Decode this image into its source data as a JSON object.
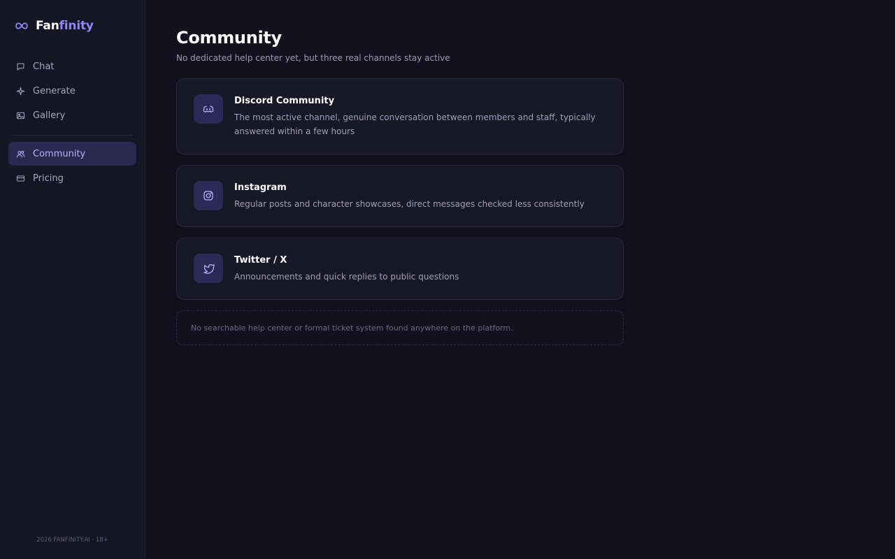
{
  "brand": {
    "prefix": "Fan",
    "suffix": "finity",
    "icon": "infinity-icon",
    "accent": "#8f86ff"
  },
  "sidebar": {
    "items": [
      {
        "label": "Chat",
        "icon": "chat-icon",
        "active": false
      },
      {
        "label": "Generate",
        "icon": "sparkle-icon",
        "active": false
      },
      {
        "label": "Gallery",
        "icon": "image-icon",
        "active": false
      },
      {
        "label": "Community",
        "icon": "users-icon",
        "active": true
      },
      {
        "label": "Pricing",
        "icon": "credit-card-icon",
        "active": false
      }
    ],
    "footer": "2026 FANFINITY.AI · 18+"
  },
  "main": {
    "title": "Community",
    "subtitle": "No dedicated help center yet, but three real channels stay active",
    "channels": [
      {
        "title": "Discord Community",
        "icon": "discord-icon",
        "description": "The most active channel, genuine conversation between members and staff, typically answered within a few hours"
      },
      {
        "title": "Instagram",
        "icon": "instagram-icon",
        "description": "Regular posts and character showcases, direct messages checked less consistently"
      },
      {
        "title": "Twitter / X",
        "icon": "twitter-icon",
        "description": "Announcements and quick replies to public questions"
      }
    ],
    "note": "No searchable help center or formal ticket system found anywhere on the platform."
  },
  "colors": {
    "background": "#12111d",
    "sidebar": "#161523",
    "card": "#181725",
    "icon_tile": "#2b2a57",
    "active_nav": "#2a2850"
  }
}
